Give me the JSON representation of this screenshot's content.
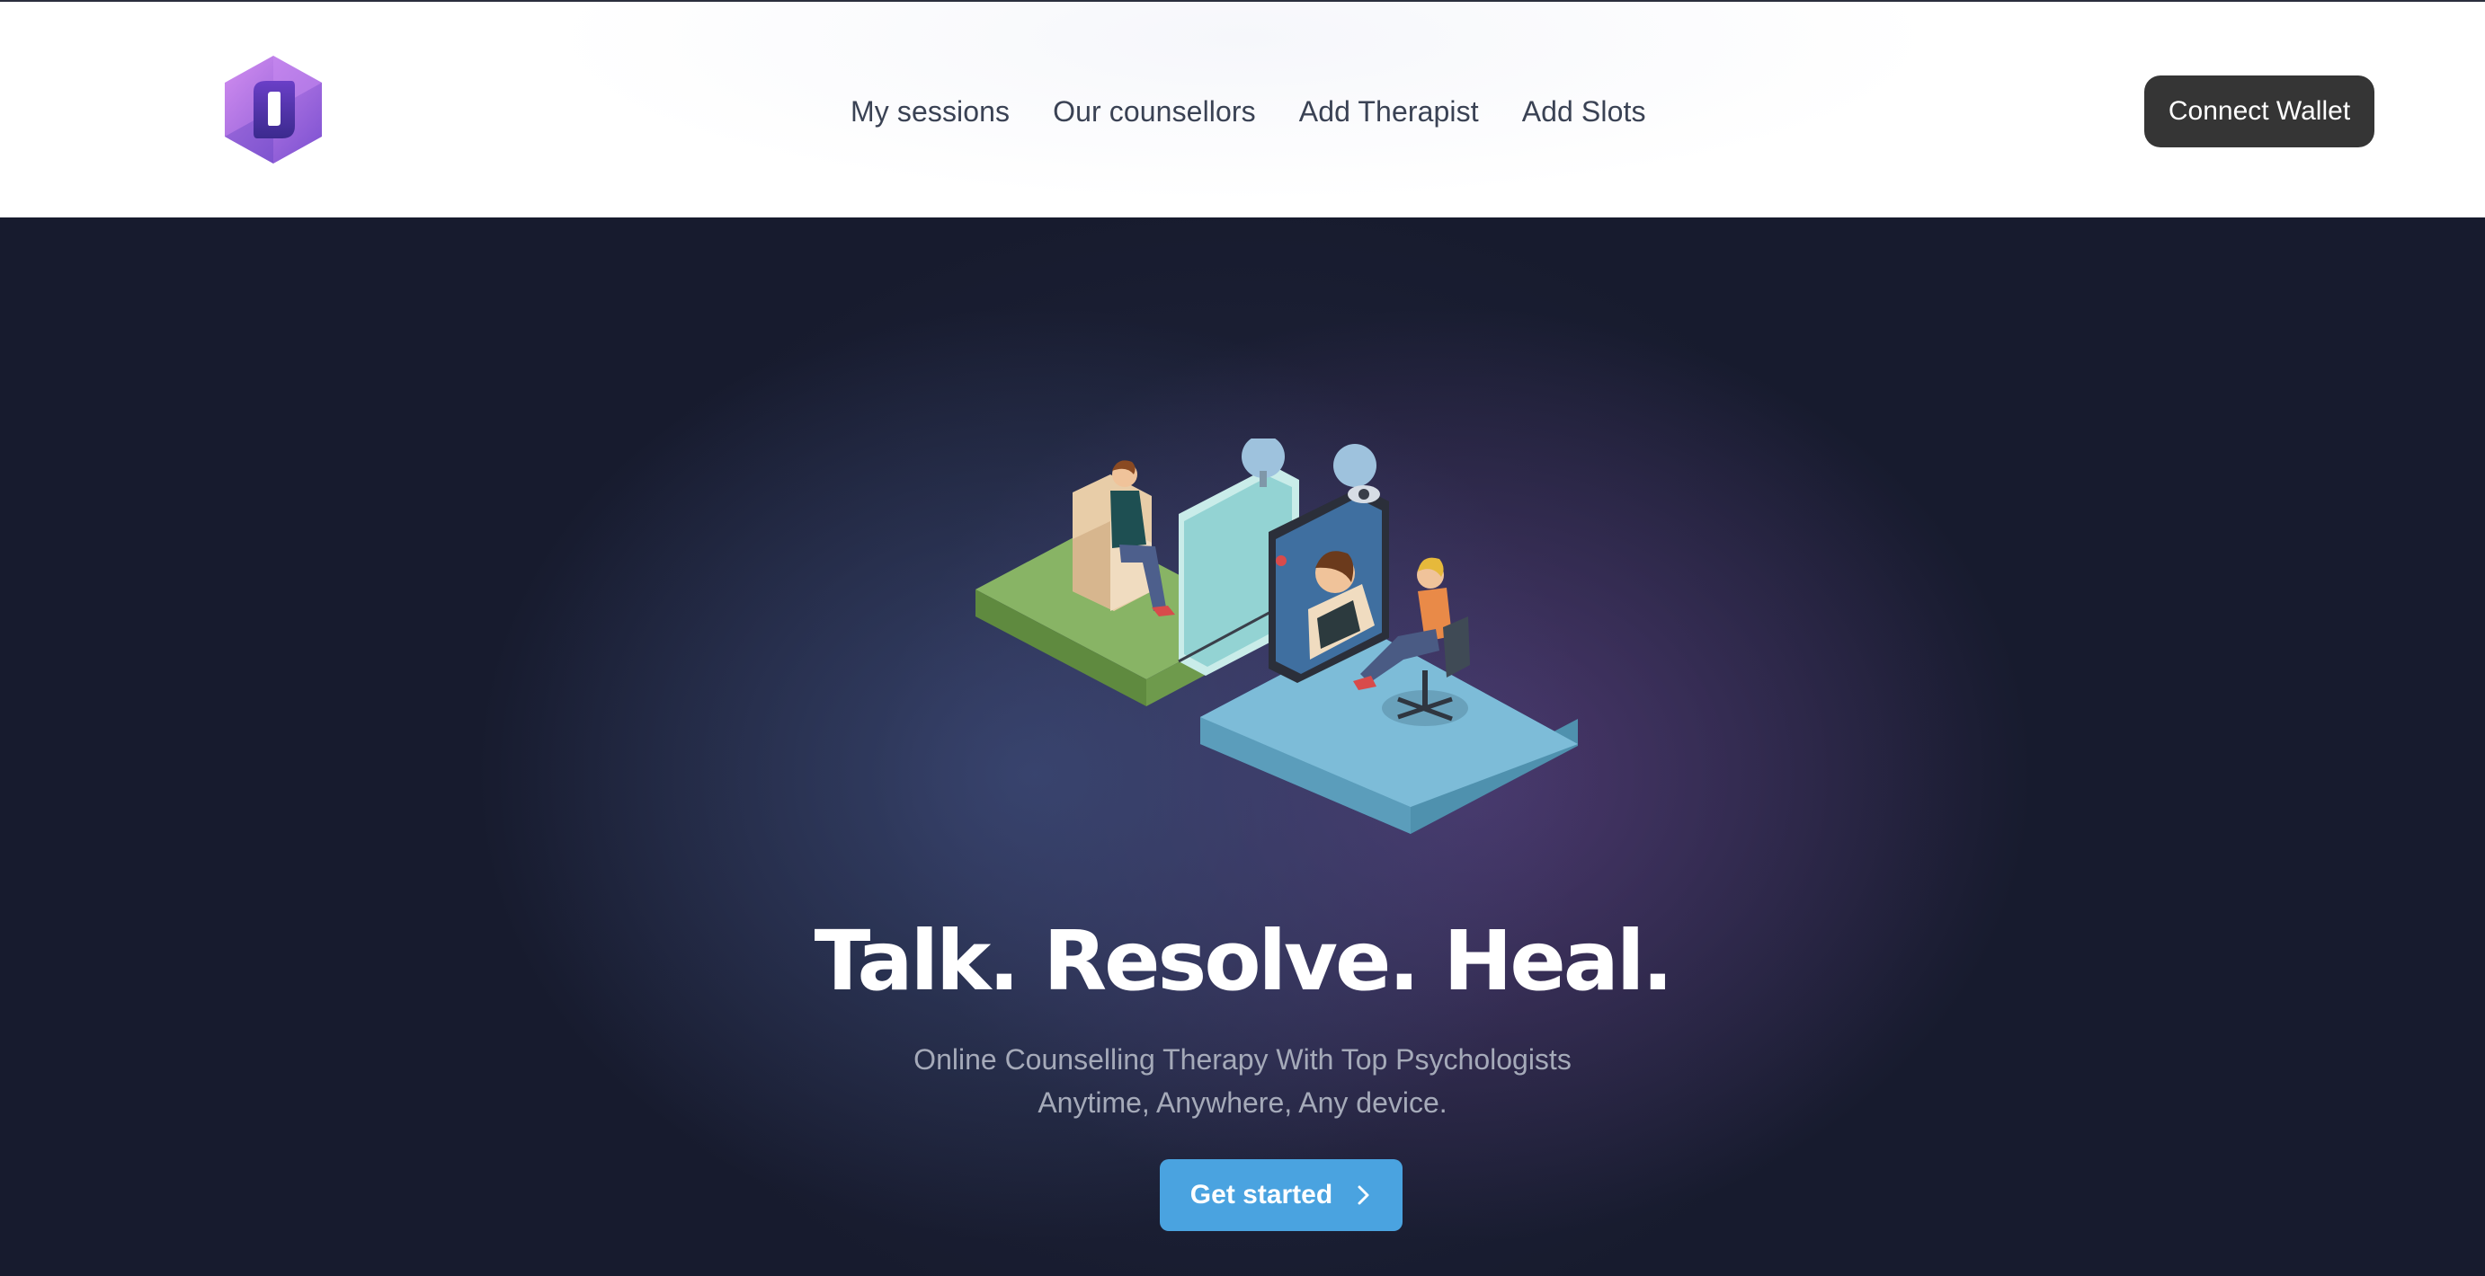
{
  "nav": {
    "logo": "hexagon-logo-icon",
    "links": [
      {
        "label": "My sessions"
      },
      {
        "label": "Our counsellors"
      },
      {
        "label": "Add Therapist"
      },
      {
        "label": "Add Slots"
      }
    ],
    "connect_wallet": "Connect Wallet"
  },
  "hero": {
    "illustration": "online-therapy-session-illustration",
    "headline": "Talk. Resolve. Heal.",
    "subtitle_line1": "Online Counselling Therapy With Top Psychologists",
    "subtitle_line2": "Anytime, Anywhere, Any device.",
    "cta_label": "Get started",
    "cta_icon": "chevron-right-icon"
  },
  "colors": {
    "hero_bg": "#171b2e",
    "cta_bg": "#4aa3e0",
    "connect_bg": "#353535",
    "logo_purple": "#8a5fd8"
  }
}
